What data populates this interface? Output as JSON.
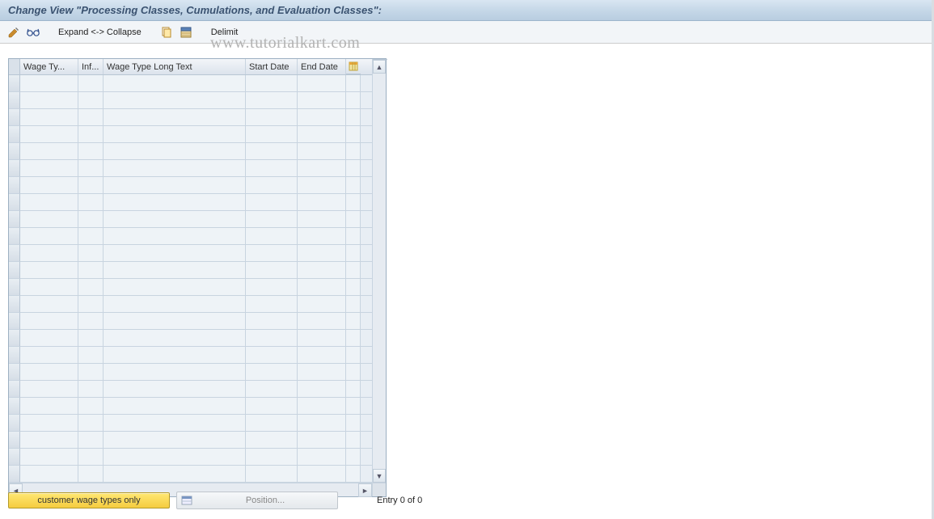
{
  "title": "Change View \"Processing Classes, Cumulations, and Evaluation Classes\":",
  "toolbar": {
    "expand_collapse": "Expand <-> Collapse",
    "delimit": "Delimit"
  },
  "watermark": "www.tutorialkart.com",
  "table": {
    "columns": {
      "wage_type": "Wage Ty...",
      "inf": "Inf...",
      "long_text": "Wage Type Long Text",
      "start_date": "Start Date",
      "end_date": "End Date"
    },
    "row_count": 24
  },
  "footer": {
    "customer_btn": "customer wage types only",
    "position_btn": "Position...",
    "entry_text": "Entry 0 of 0"
  }
}
